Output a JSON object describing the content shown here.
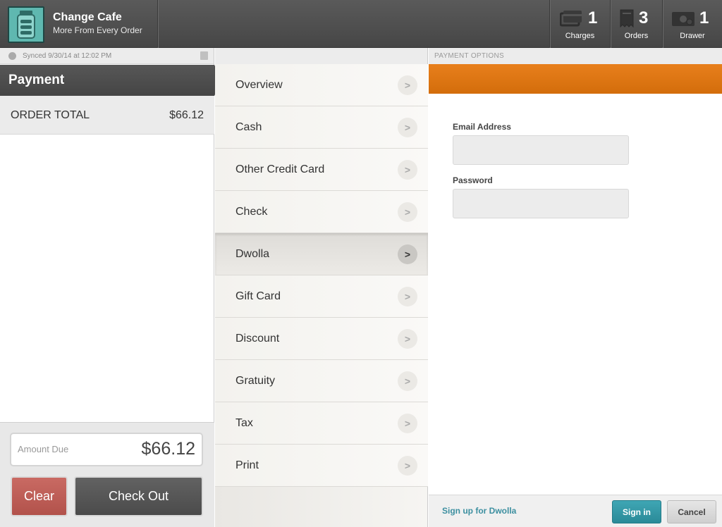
{
  "header": {
    "app_name": "Change Cafe",
    "tagline": "More From Every Order",
    "stats": [
      {
        "icon": "card-icon",
        "count": "1",
        "label": "Charges"
      },
      {
        "icon": "receipt-icon",
        "count": "3",
        "label": "Orders"
      },
      {
        "icon": "cash-drawer-icon",
        "count": "1",
        "label": "Drawer"
      }
    ]
  },
  "left": {
    "sync_text": "Synced 9/30/14 at 12:02 PM",
    "title": "Payment",
    "order_total_label": "ORDER TOTAL",
    "order_total_value": "$66.12",
    "amount_due_label": "Amount Due",
    "amount_due_value": "$66.12",
    "clear_label": "Clear",
    "checkout_label": "Check Out"
  },
  "menu": {
    "items": [
      {
        "label": "Overview"
      },
      {
        "label": "Cash"
      },
      {
        "label": "Other Credit Card"
      },
      {
        "label": "Check"
      },
      {
        "label": "Dwolla",
        "active": true
      },
      {
        "label": "Gift Card"
      },
      {
        "label": "Discount"
      },
      {
        "label": "Gratuity"
      },
      {
        "label": "Tax"
      },
      {
        "label": "Print"
      }
    ]
  },
  "right": {
    "section_title": "PAYMENT OPTIONS",
    "accent_color": "#e0790f",
    "email_label": "Email Address",
    "email_value": "",
    "password_label": "Password",
    "password_value": "",
    "signup_label": "Sign up for Dwolla",
    "signin_label": "Sign in",
    "cancel_label": "Cancel"
  }
}
